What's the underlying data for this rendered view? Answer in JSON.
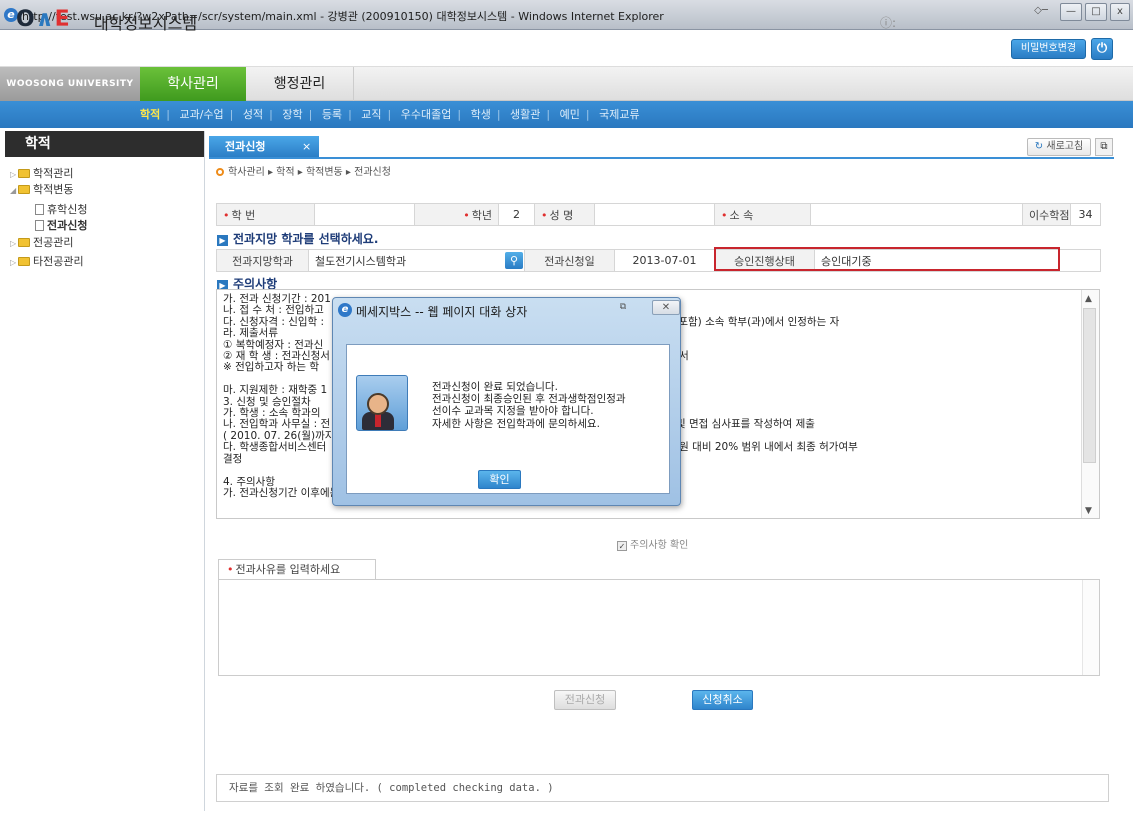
{
  "window": {
    "title": "http://test.wsu.ac.kr/?w2xPath=/scr/system/main.xml - 강병관 (200910150) 대학정보시스템 - Windows Internet Explorer",
    "ie_icon": "ie-logo-icon",
    "buttons": {
      "minimize": "—",
      "maximize": "□",
      "close": "x"
    }
  },
  "header": {
    "logo": "OAE",
    "system_title": "대학정보시스템",
    "change_password": "비밀번호변경",
    "power": "⏻",
    "indicator": "ⓘ:"
  },
  "nav": {
    "university": "WOOSONG UNIVERSITY",
    "tabs": [
      {
        "label": "학사관리",
        "active": true
      },
      {
        "label": "행정관리",
        "active": false
      }
    ],
    "sub_items": [
      "학적",
      "교과/수업",
      "성적",
      "장학",
      "등록",
      "교직",
      "우수대졸업",
      "학생",
      "생활관",
      "예민",
      "국제교류"
    ]
  },
  "sidebar": {
    "title": "학적",
    "items": [
      {
        "label": "학적관리",
        "type": "folder",
        "level": 0
      },
      {
        "label": "학적변동",
        "type": "folder",
        "level": 0
      },
      {
        "label": "휴학신청",
        "type": "doc",
        "level": 1
      },
      {
        "label": "전과신청",
        "type": "doc",
        "level": 1
      },
      {
        "label": "전공관리",
        "type": "folder",
        "level": 0
      },
      {
        "label": "타전공관리",
        "type": "folder",
        "level": 0
      }
    ]
  },
  "content": {
    "tab_label": "전과신청",
    "tab_close": "×",
    "refresh": "새로고침",
    "breadcrumb": "학사관리 ▸ 학적 ▸ 학적변동 ▸ 전과신청",
    "student": {
      "id_label": "학 번",
      "id_value": "",
      "grade_label": "학년",
      "grade_value": "2",
      "name_label": "성 명",
      "name_value": "",
      "dept_label": "소 속",
      "dept_value": "",
      "credits_label": "이수학점",
      "credits_value": "34"
    },
    "select_section": "전과지망 학과를 선택하세요.",
    "apply": {
      "desired_dept_label": "전과지망학과",
      "desired_dept_value": "철도전기시스템학과",
      "apply_date_label": "전과신청일",
      "apply_date_value": "2013-07-01",
      "approval_label": "승인진행상태",
      "approval_value": "승인대기중"
    },
    "notice_section": "주의사항",
    "notice_lines": [
      "가. 전과 신청기간 : 201",
      "나. 접 수 처 : 전입하고",
      "다. 신청자격 : 신입학 :                                                                          기 2, 3학년 복학예정자 포함) 소속 학부(과)에서 인정하는 자",
      "라. 제출서류",
      "① 복학예정자 : 전과신                                                              교과목 지정표, 성적증명서, 서약서",
      "② 재 학 생 : 전과신청서                                                              목 지정표, 성적증명서, 수강신청서",
      "※ 전입하고자 하는 학",
      "",
      "마. 지원제한 : 재학중 1",
      "3. 신청 및 승인절차",
      "가. 학생 : 소속 학과의",
      "나. 전입학과 사무실 : 전                                                             점인정표, 선이수 교과목 지정표 및 면접 심사표를 작성하여 제출",
      "( 2010. 07. 26(월)까지",
      "다. 학생종합서비스센터                                                             하여 100점 만점 기준으로 편제정원 대비 20% 범위 내에서 최종 허가여부",
      "결정",
      "",
      "4. 주의사항",
      "가. 전과신청기간 이후에는 전과 불가"
    ],
    "confirm_checkbox": "주의사항 확인",
    "reason_placeholder": "전과사유를 입력하세요",
    "apply_button": "전과신청",
    "cancel_button": "신청취소",
    "status_message": "자료를 조회 완료 하였습니다. ( completed checking data. )"
  },
  "dialog": {
    "title": "메세지박스 -- 웹 페이지 대화 상자",
    "message": "전과신청이 완료 되었습니다.\n전과신청이 최종승인된 후 전과생학점인정과\n선이수 교과목 지정을 받아야 합니다.\n자세한 사항은 전입학과에 문의하세요.",
    "ok_button": "확인",
    "icon": "user-folder-icon"
  },
  "colors": {
    "accent_blue": "#2a78bf",
    "accent_green": "#4aa62a",
    "highlight_red": "#c8252d"
  }
}
